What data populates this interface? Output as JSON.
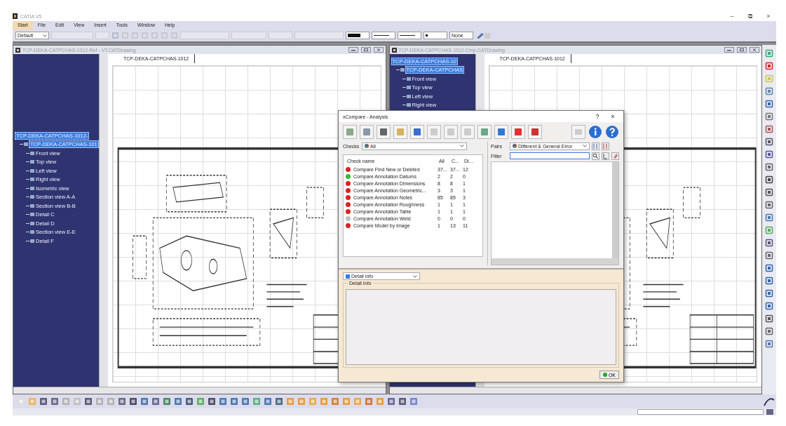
{
  "window": {
    "title": "CATIA V5",
    "controls": [
      "–",
      "⧉",
      "×"
    ]
  },
  "menu": [
    {
      "label": "Start",
      "selected": true
    },
    {
      "label": "File",
      "selected": false
    },
    {
      "label": "Edit",
      "selected": false
    },
    {
      "label": "View",
      "selected": false
    },
    {
      "label": "Insert",
      "selected": false
    },
    {
      "label": "Tools",
      "selected": false
    },
    {
      "label": "Window",
      "selected": false
    },
    {
      "label": "Help",
      "selected": false
    }
  ],
  "toolbar": {
    "style_combo": "Default",
    "line_combo": "None"
  },
  "documents": [
    {
      "title": "TCP-DEKA-CATPCHAS-1012-Ref - VT.CATDrawing",
      "tab": "TCP-DEKA-CATPCHAS-1012",
      "tree": [
        {
          "label": "TCP-DEKA-CATPCHAS-1012-",
          "selected": true,
          "children": [
            {
              "label": "TCP-DEKA-CATPCHAS-101",
              "selected": true,
              "children": [
                {
                  "label": "Front view",
                  "selected": false
                },
                {
                  "label": "Top view",
                  "selected": false
                },
                {
                  "label": "Left view",
                  "selected": false
                },
                {
                  "label": "Right view",
                  "selected": false
                },
                {
                  "label": "Isometric view",
                  "selected": false
                },
                {
                  "label": "Section view A-A",
                  "selected": false
                },
                {
                  "label": "Section view B-B",
                  "selected": false
                },
                {
                  "label": "Detail C",
                  "selected": false
                },
                {
                  "label": "Detail D",
                  "selected": false
                },
                {
                  "label": "Section view E-E",
                  "selected": false
                },
                {
                  "label": "Detail F",
                  "selected": false
                }
              ]
            }
          ]
        }
      ]
    },
    {
      "title": "TCP-DEKA-CATPCHAS-1012-Cmp.CATDrawing",
      "tab": "TCP-DEKA-CATPCHAS-1012",
      "tree": [
        {
          "label": "TCP-DEKA-CATPCHAS-10",
          "selected": true,
          "children": [
            {
              "label": "TCP-DEKA-CATPCHAS",
              "selected": true,
              "children": [
                {
                  "label": "Front view",
                  "selected": false
                },
                {
                  "label": "Top view",
                  "selected": false
                },
                {
                  "label": "Left view",
                  "selected": false
                },
                {
                  "label": "Right view",
                  "selected": false
                }
              ]
            }
          ]
        }
      ]
    }
  ],
  "dialog": {
    "title": "xCompare - Analysis",
    "help": "?",
    "close": "×",
    "checks_label": "Checks",
    "checks_value": "All",
    "pairs_label": "Pairs",
    "pairs_value": "Different & General Error",
    "filter_label": "Filter",
    "columns": [
      "Check name",
      "All",
      "C...",
      "Di..."
    ],
    "rows": [
      {
        "name": "Compare Find New or Deleted",
        "all": "37...",
        "compared": "37...",
        "different": "12",
        "color": "#e02020"
      },
      {
        "name": "Compare Annotation Datums",
        "all": "2",
        "compared": "2",
        "different": "0",
        "color": "#30c030"
      },
      {
        "name": "Compare Annotation Dimensions",
        "all": "8",
        "compared": "8",
        "different": "1",
        "color": "#e02020"
      },
      {
        "name": "Compare Annotation Geometric...",
        "all": "3",
        "compared": "3",
        "different": "1",
        "color": "#e02020"
      },
      {
        "name": "Compare Annotation Notes",
        "all": "85",
        "compared": "85",
        "different": "3",
        "color": "#e02020"
      },
      {
        "name": "Compare Annotation Roughness",
        "all": "1",
        "compared": "1",
        "different": "1",
        "color": "#e02020"
      },
      {
        "name": "Compare Annotation Table",
        "all": "1",
        "compared": "1",
        "different": "1",
        "color": "#e02020"
      },
      {
        "name": "Compare Annotation Weld",
        "all": "0",
        "compared": "0",
        "different": "0",
        "color": "#c0c0c0"
      },
      {
        "name": "Compare Model by Image",
        "all": "1",
        "compared": "13",
        "different": "11",
        "color": "#e02020"
      }
    ],
    "detail_combo": "Detail info",
    "detail_group": "Detail Info",
    "ok": "OK"
  }
}
